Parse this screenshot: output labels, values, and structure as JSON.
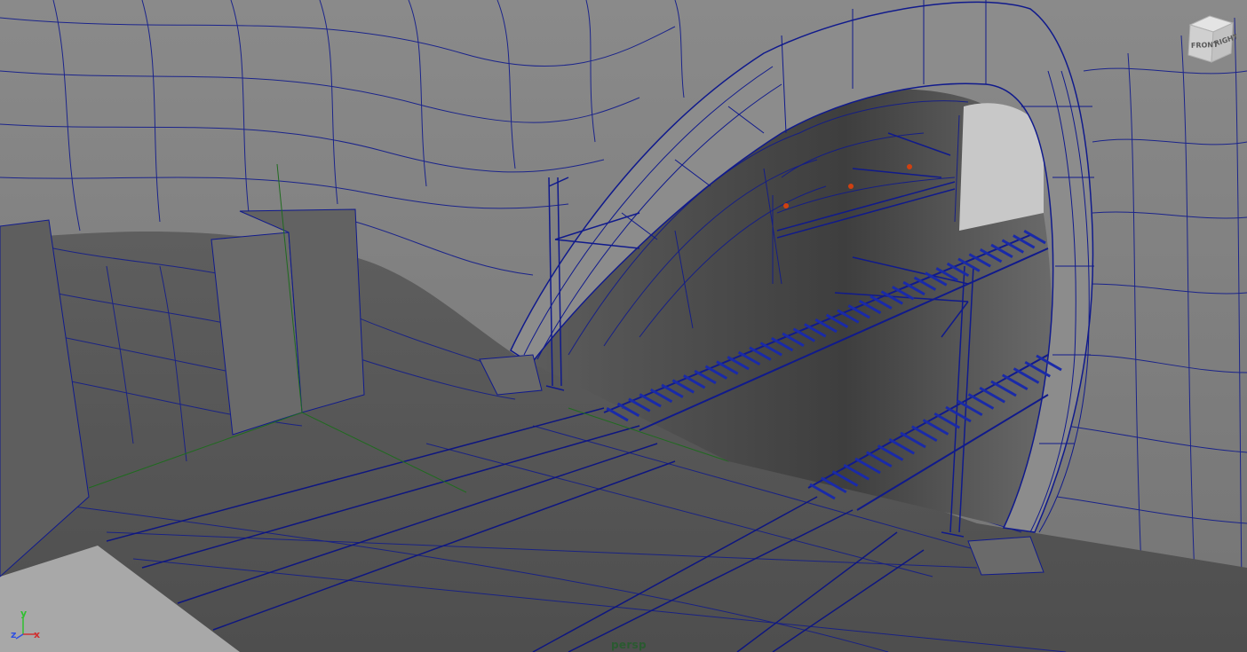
{
  "viewport": {
    "camera": "persp",
    "mode": "wireframe-on-shaded"
  },
  "viewcube": {
    "front": "FRONT",
    "right": "RIGHT"
  },
  "axis": {
    "x": "x",
    "y": "y",
    "z": "z"
  },
  "colors": {
    "wire": "#101a8c",
    "grid": "#1f6b1f",
    "surface": "#7b7b7b",
    "dark_surface": "#5a5a5a",
    "marker": "#d04010",
    "sky": "#c8c8c8"
  }
}
